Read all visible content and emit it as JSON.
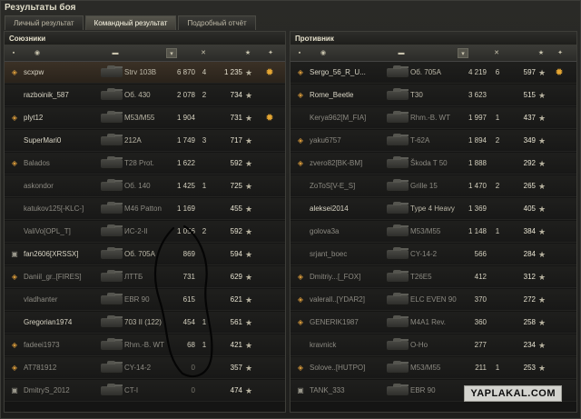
{
  "window": {
    "title": "Результаты боя"
  },
  "tabs": [
    {
      "label": "Личный результат",
      "active": false
    },
    {
      "label": "Командный результат",
      "active": true
    },
    {
      "label": "Подробный отчёт",
      "active": false
    }
  ],
  "allies": {
    "title": "Союзники",
    "header_icons": [
      "platoon-icon",
      "player-icon",
      "tank-icon",
      "damage-icon",
      "frags-icon",
      "xp-icon",
      "medal-icon"
    ],
    "rows": [
      {
        "icon": "clan-icon",
        "name": "scxpw",
        "tank": "Strv 103B",
        "damage": "6 870",
        "frags": "4",
        "xp": "1 235",
        "medal": "medal-icon",
        "self": true,
        "dead": false
      },
      {
        "icon": "",
        "name": "razboinik_587",
        "tank": "Об. 430",
        "damage": "2 078",
        "frags": "2",
        "xp": "734",
        "medal": "",
        "self": false,
        "dead": false
      },
      {
        "icon": "clan-icon",
        "name": "plyt12",
        "tank": "M53/M55",
        "damage": "1 904",
        "frags": "",
        "xp": "731",
        "medal": "medal-icon",
        "self": false,
        "dead": false
      },
      {
        "icon": "",
        "name": "SuperMari0",
        "tank": "212A",
        "damage": "1 749",
        "frags": "3",
        "xp": "717",
        "medal": "",
        "self": false,
        "dead": false
      },
      {
        "icon": "clan-icon",
        "name": "Balados",
        "tank": "T28 Prot.",
        "damage": "1 622",
        "frags": "",
        "xp": "592",
        "medal": "",
        "self": false,
        "dead": true
      },
      {
        "icon": "",
        "name": "askondor",
        "tank": "Об. 140",
        "damage": "1 425",
        "frags": "1",
        "xp": "725",
        "medal": "",
        "self": false,
        "dead": true
      },
      {
        "icon": "",
        "name": "katukov125[-KLC-]",
        "tank": "M46 Patton",
        "damage": "1 169",
        "frags": "",
        "xp": "455",
        "medal": "",
        "self": false,
        "dead": true
      },
      {
        "icon": "",
        "name": "ValiVo[OPL_T]",
        "tank": "ИС-2-II",
        "damage": "1 056",
        "frags": "2",
        "xp": "592",
        "medal": "",
        "self": false,
        "dead": true
      },
      {
        "icon": "platoon-icon",
        "name": "fan2606[XRSSX]",
        "tank": "Об. 705А",
        "damage": "869",
        "frags": "",
        "xp": "594",
        "medal": "",
        "self": false,
        "dead": false
      },
      {
        "icon": "clan-icon",
        "name": "Daniil_gr..[FIRES]",
        "tank": "ЛТТБ",
        "damage": "731",
        "frags": "",
        "xp": "629",
        "medal": "",
        "self": false,
        "dead": true
      },
      {
        "icon": "",
        "name": "vladhanter",
        "tank": "EBR 90",
        "damage": "615",
        "frags": "",
        "xp": "621",
        "medal": "",
        "self": false,
        "dead": true
      },
      {
        "icon": "",
        "name": "Gregorian1974",
        "tank": "703 II (122)",
        "damage": "454",
        "frags": "1",
        "xp": "561",
        "medal": "",
        "self": false,
        "dead": false
      },
      {
        "icon": "clan-icon",
        "name": "fadeei1973",
        "tank": "Rhm.-B. WT",
        "damage": "68",
        "frags": "1",
        "xp": "421",
        "medal": "",
        "self": false,
        "dead": true
      },
      {
        "icon": "clan-icon",
        "name": "AT781912",
        "tank": "CY-14-2",
        "damage": "0",
        "frags": "",
        "xp": "357",
        "medal": "",
        "self": false,
        "dead": true
      },
      {
        "icon": "platoon-icon",
        "name": "DmitryS_2012",
        "tank": "CT-I",
        "damage": "0",
        "frags": "",
        "xp": "474",
        "medal": "",
        "self": false,
        "dead": true
      }
    ]
  },
  "enemies": {
    "title": "Противник",
    "rows": [
      {
        "icon": "clan-icon",
        "name": "Sergo_56_R_U...",
        "tank": "Об. 705А",
        "damage": "4 219",
        "frags": "6",
        "xp": "597",
        "medal": "medal-icon",
        "dead": false
      },
      {
        "icon": "clan-icon",
        "name": "Rome_Beetle",
        "tank": "T30",
        "damage": "3 623",
        "frags": "",
        "xp": "515",
        "medal": "",
        "dead": false
      },
      {
        "icon": "",
        "name": "Kerya962[M_FIA]",
        "tank": "Rhm.-B. WT",
        "damage": "1 997",
        "frags": "1",
        "xp": "437",
        "medal": "",
        "dead": true
      },
      {
        "icon": "clan-icon",
        "name": "yaku6757",
        "tank": "T-62A",
        "damage": "1 894",
        "frags": "2",
        "xp": "349",
        "medal": "",
        "dead": true
      },
      {
        "icon": "clan-icon",
        "name": "zvero82[BK-BM]",
        "tank": "Škoda T 50",
        "damage": "1 888",
        "frags": "",
        "xp": "292",
        "medal": "",
        "dead": true
      },
      {
        "icon": "",
        "name": "ZoToS[V-E_S]",
        "tank": "Grille 15",
        "damage": "1 470",
        "frags": "2",
        "xp": "265",
        "medal": "",
        "dead": true
      },
      {
        "icon": "",
        "name": "aleksei2014",
        "tank": "Type 4 Heavy",
        "damage": "1 369",
        "frags": "",
        "xp": "405",
        "medal": "",
        "dead": false
      },
      {
        "icon": "",
        "name": "golova3a",
        "tank": "M53/M55",
        "damage": "1 148",
        "frags": "1",
        "xp": "384",
        "medal": "",
        "dead": true
      },
      {
        "icon": "",
        "name": "srjant_boec",
        "tank": "CY-14-2",
        "damage": "566",
        "frags": "",
        "xp": "284",
        "medal": "",
        "dead": true
      },
      {
        "icon": "clan-icon",
        "name": "Dmitriy...[_FOX]",
        "tank": "T26E5",
        "damage": "412",
        "frags": "",
        "xp": "312",
        "medal": "",
        "dead": true
      },
      {
        "icon": "clan-icon",
        "name": "valerall..[YDAR2]",
        "tank": "ELC EVEN 90",
        "damage": "370",
        "frags": "",
        "xp": "272",
        "medal": "",
        "dead": true
      },
      {
        "icon": "clan-icon",
        "name": "GENERIK1987",
        "tank": "M4A1 Rev.",
        "damage": "360",
        "frags": "",
        "xp": "258",
        "medal": "",
        "dead": true
      },
      {
        "icon": "",
        "name": "kravnick",
        "tank": "O-Ho",
        "damage": "277",
        "frags": "",
        "xp": "234",
        "medal": "",
        "dead": true
      },
      {
        "icon": "clan-icon",
        "name": "Solove..[HUTPO]",
        "tank": "M53/M55",
        "damage": "211",
        "frags": "1",
        "xp": "253",
        "medal": "",
        "dead": true
      },
      {
        "icon": "platoon-icon",
        "name": "TANK_333",
        "tank": "EBR 90",
        "damage": "0",
        "frags": "",
        "xp": "383",
        "medal": "",
        "dead": true
      }
    ]
  },
  "watermark": "YAPLAKAL.COM",
  "colors": {
    "accent": "#e6a733",
    "self_row": "#3b3126",
    "background": "#1b1b1a"
  }
}
